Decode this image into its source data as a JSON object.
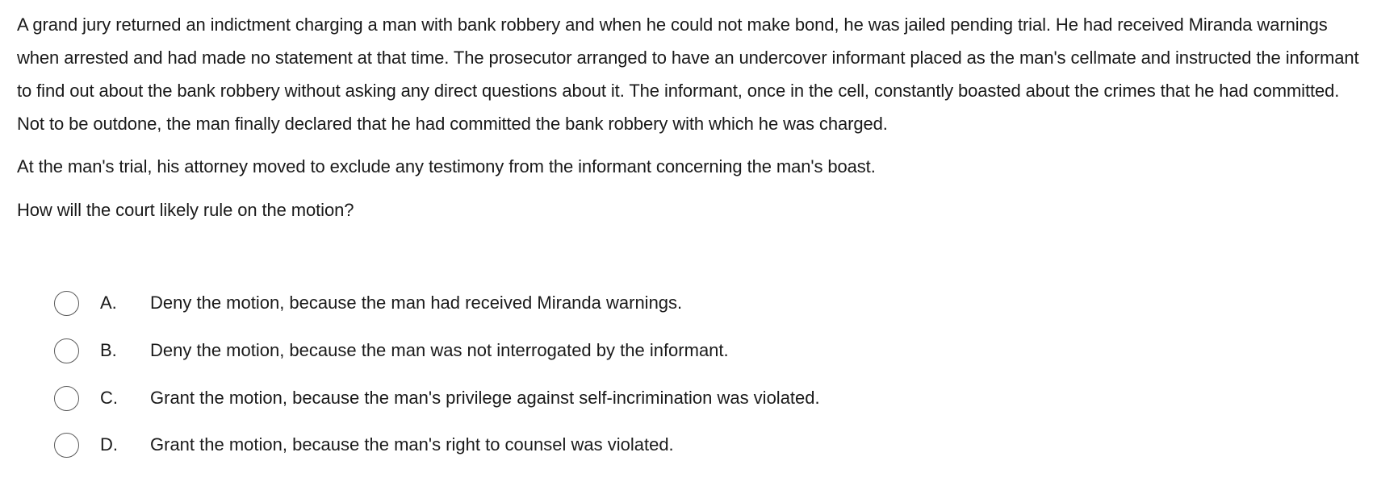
{
  "question": {
    "stem_paragraphs": [
      "A grand jury returned an indictment charging a man with bank robbery and when he could not make bond, he was jailed pending trial.  He had received Miranda warnings when arrested and had made no statement at that time.  The prosecutor arranged to have an undercover informant placed as the man's cellmate and instructed the informant to find out about the bank robbery without asking any direct questions about it.  The informant, once in the cell, constantly boasted about the crimes that he had committed.  Not to be outdone, the man finally declared that he had committed the bank robbery with which he was charged.",
      "At the man's trial, his attorney moved to exclude any testimony from the informant concerning the man's boast.",
      "How will the court likely rule on the motion?"
    ],
    "choices": [
      {
        "letter": "A.",
        "text": "Deny the motion, because the man had received Miranda warnings.",
        "selected": false
      },
      {
        "letter": "B.",
        "text": "Deny the motion, because the man was not interrogated by the informant.",
        "selected": false
      },
      {
        "letter": "C.",
        "text": "Grant the motion, because the man's privilege against self-incrimination was violated.",
        "selected": false
      },
      {
        "letter": "D.",
        "text": "Grant the motion, because the man's right to counsel was violated.",
        "selected": false
      }
    ]
  },
  "colors": {
    "text": "#1a1a1a",
    "radio_border": "#5a5a5a",
    "background": "#ffffff"
  }
}
